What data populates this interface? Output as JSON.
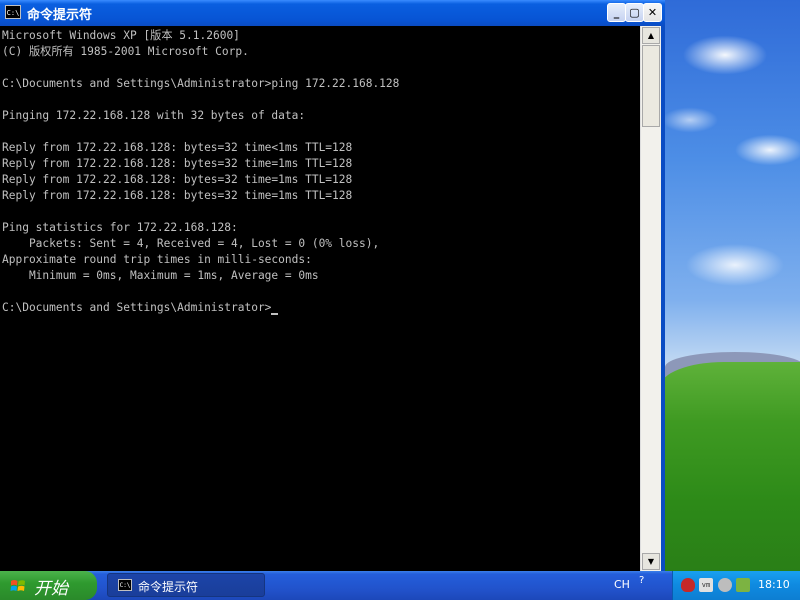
{
  "window": {
    "title": "命令提示符",
    "icon_text": "C:\\",
    "min_label": "_",
    "max_label": "▢",
    "close_label": "✕"
  },
  "console": {
    "lines": [
      "Microsoft Windows XP [版本 5.1.2600]",
      "(C) 版权所有 1985-2001 Microsoft Corp.",
      "",
      "C:\\Documents and Settings\\Administrator>ping 172.22.168.128",
      "",
      "Pinging 172.22.168.128 with 32 bytes of data:",
      "",
      "Reply from 172.22.168.128: bytes=32 time<1ms TTL=128",
      "Reply from 172.22.168.128: bytes=32 time=1ms TTL=128",
      "Reply from 172.22.168.128: bytes=32 time=1ms TTL=128",
      "Reply from 172.22.168.128: bytes=32 time=1ms TTL=128",
      "",
      "Ping statistics for 172.22.168.128:",
      "    Packets: Sent = 4, Received = 4, Lost = 0 (0% loss),",
      "Approximate round trip times in milli-seconds:",
      "    Minimum = 0ms, Maximum = 1ms, Average = 0ms",
      "",
      "C:\\Documents and Settings\\Administrator>"
    ]
  },
  "taskbar": {
    "start_label": "开始",
    "task_label": "命令提示符",
    "task_icon_text": "C:\\",
    "lang": "CH",
    "lang_help": "?",
    "vm_icon_text": "vm",
    "clock": "18:10"
  },
  "colors": {
    "console_bg": "#000000",
    "console_fg": "#c0c0c0",
    "titlebar": "#0754d4",
    "start_green": "#2f9a2f"
  }
}
